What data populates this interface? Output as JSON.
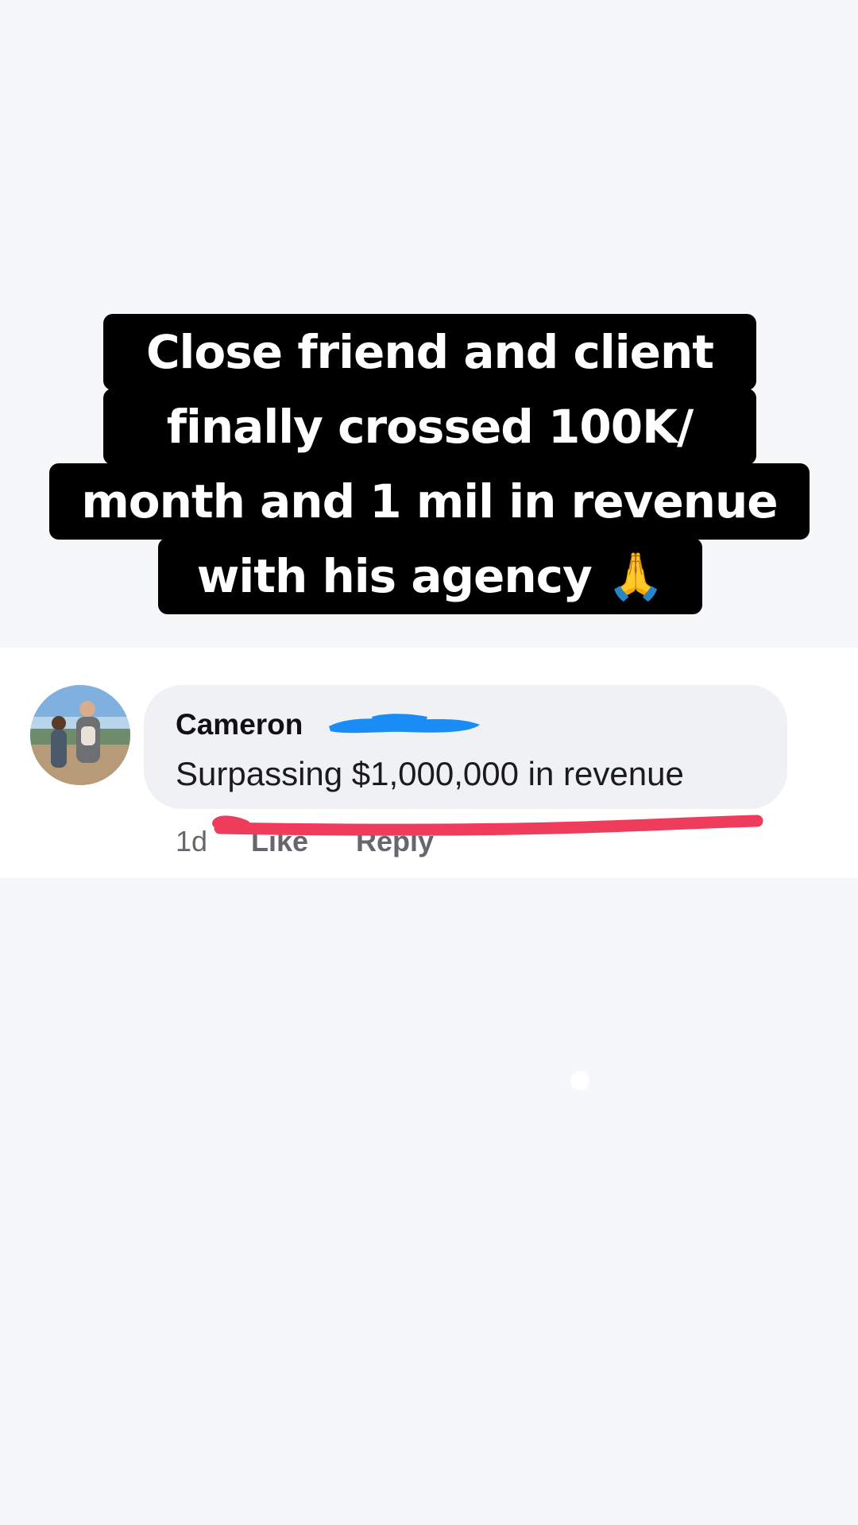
{
  "caption": {
    "lines": [
      "Close friend and client",
      "finally crossed 100K/",
      "month and 1 mil in revenue",
      "with his agency 🙏"
    ]
  },
  "comment": {
    "author": "Cameron",
    "text": "Surpassing $1,000,000 in revenue",
    "time": "1d",
    "like_label": "Like",
    "reply_label": "Reply"
  },
  "colors": {
    "background": "#f6f7f9",
    "bubble": "#eff1f5",
    "redaction": "#1a8cf5",
    "underline": "#ef3c5d"
  },
  "icons": {
    "avatar": "profile-photo",
    "redaction": "blue-scribble",
    "underline": "red-underline-stroke"
  }
}
